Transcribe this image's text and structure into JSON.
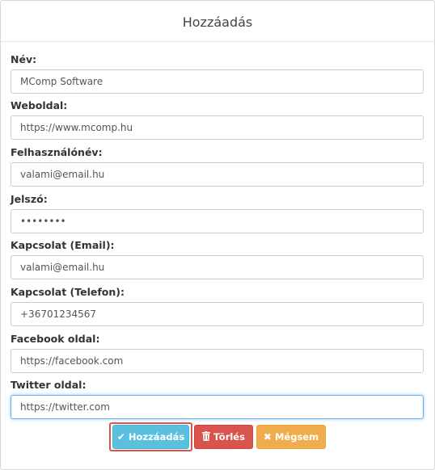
{
  "modal": {
    "title": "Hozzáadás"
  },
  "fields": [
    {
      "label": "Név:",
      "value": "MComp Software"
    },
    {
      "label": "Weboldal:",
      "value": "https://www.mcomp.hu"
    },
    {
      "label": "Felhasználónév:",
      "value": "valami@email.hu"
    },
    {
      "label": "Jelszó:",
      "value": "••••••••"
    },
    {
      "label": "Kapcsolat (Email):",
      "value": "valami@email.hu"
    },
    {
      "label": "Kapcsolat (Telefon):",
      "value": "+36701234567"
    },
    {
      "label": "Facebook oldal:",
      "value": "https://facebook.com"
    },
    {
      "label": "Twitter oldal:",
      "value": "https://twitter.com"
    }
  ],
  "buttons": {
    "add": {
      "label": "Hozzáadás",
      "icon": "check-icon"
    },
    "delete": {
      "label": "Törlés",
      "icon": "trash-icon"
    },
    "cancel": {
      "label": "Mégsem",
      "icon": "times-icon"
    }
  },
  "colors": {
    "add": "#5bc0de",
    "delete": "#d9534f",
    "cancel": "#f0ad4e",
    "highlight": "#d9534f",
    "focus": "#66afe9"
  }
}
